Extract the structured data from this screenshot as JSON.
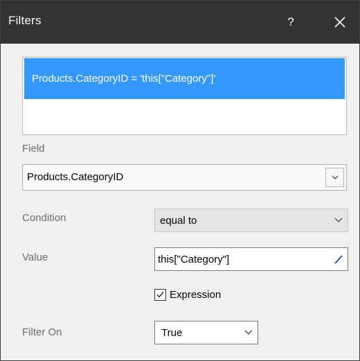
{
  "window": {
    "title": "Filters",
    "help_label": "?"
  },
  "filters": {
    "items": [
      {
        "label": "Products.CategoryID = 'this[\"Category\"]'",
        "selected": true
      }
    ]
  },
  "field": {
    "label": "Field",
    "value": "Products.CategoryID"
  },
  "condition": {
    "label": "Condition",
    "value": "equal to"
  },
  "value": {
    "label": "Value",
    "text": "this[\"Category\"]"
  },
  "expression": {
    "label": "Expression",
    "checked": true
  },
  "filter_on": {
    "label": "Filter On",
    "value": "True"
  },
  "colors": {
    "titlebar": "#333333",
    "selection": "#3399ff",
    "pencil": "#1e5fa8"
  },
  "icons": {
    "help": "help-icon",
    "close": "close-icon",
    "dropdown": "chevron-down-icon",
    "edit": "pencil-icon",
    "check": "check-icon"
  }
}
